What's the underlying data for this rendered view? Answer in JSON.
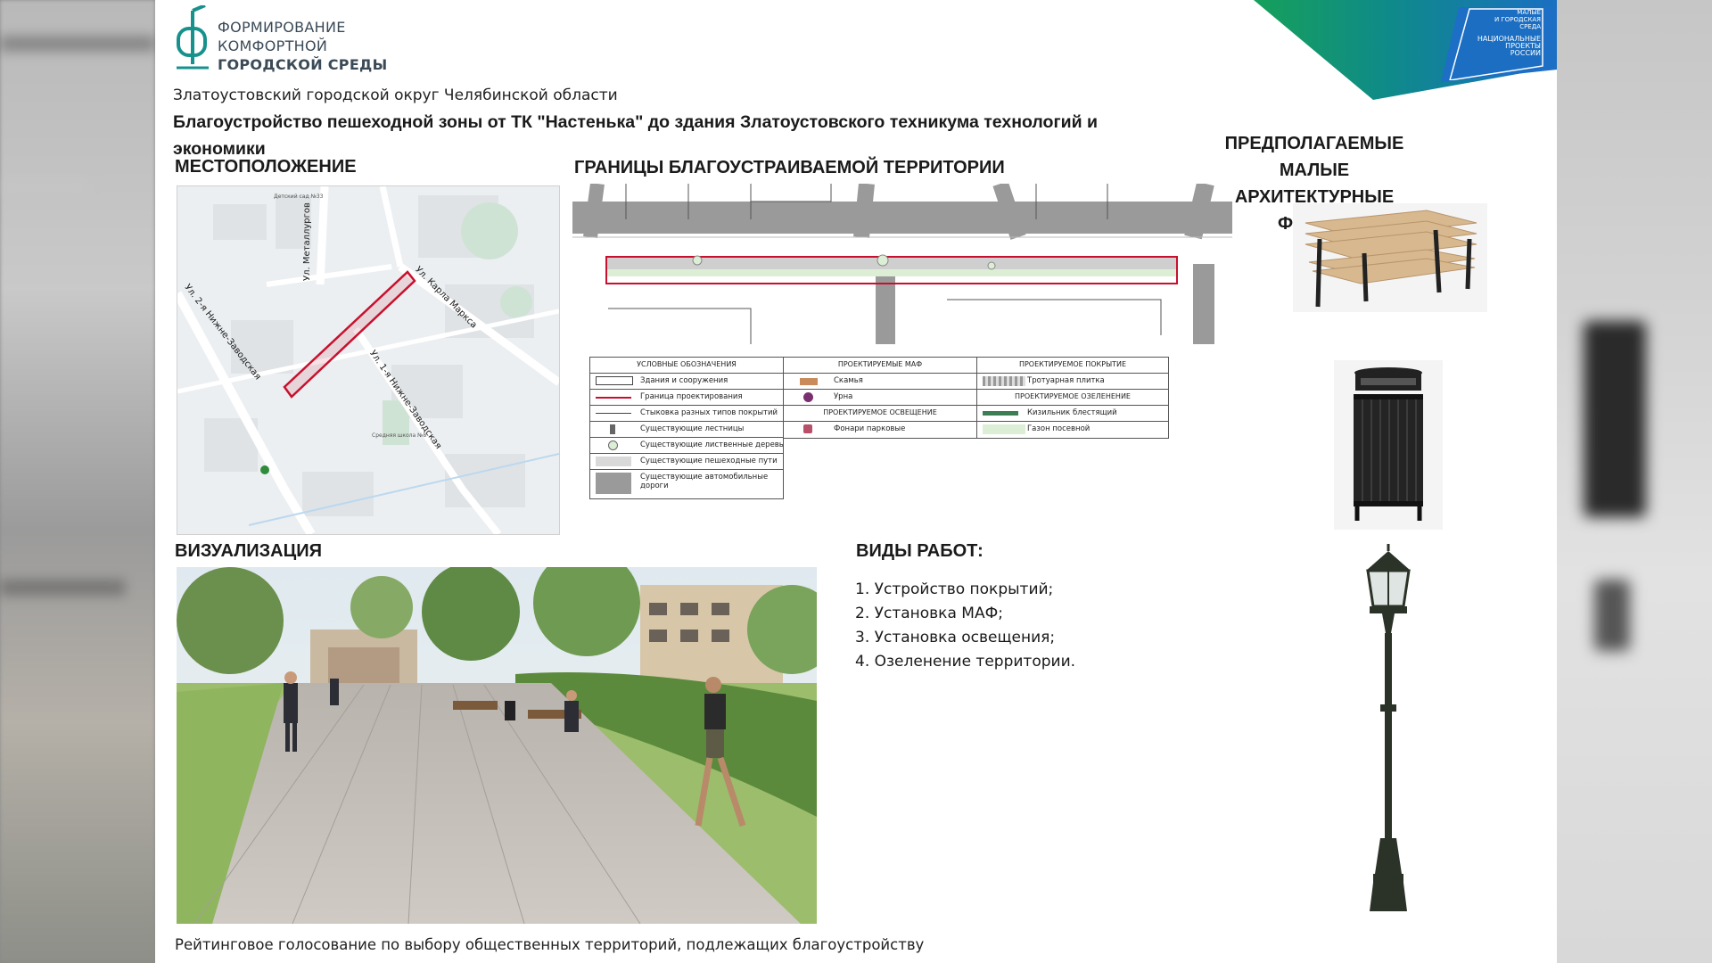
{
  "logo": {
    "line1": "ФОРМИРОВАНИЕ",
    "line2": "КОМФОРТНОЙ",
    "line3": "ГОРОДСКОЙ СРЕДЫ"
  },
  "national_projects": {
    "line1": "МАЛЫЕ",
    "line2": "И ГОРОДСКАЯ СРЕДА",
    "line3": "НАЦИОНАЛЬНЫЕ",
    "line4": "ПРОЕКТЫ",
    "line5": "РОССИИ"
  },
  "region": "Златоустовский городской округ Челябинской области",
  "project_title_line1": "Благоустройство пешеходной зоны от ТК \"Настенька\" до здания Златоустовского техникума технологий и",
  "project_title_line2": "экономики",
  "sections": {
    "location": "МЕСТОПОЛОЖЕНИЕ",
    "borders": "ГРАНИЦЫ БЛАГОУСТРАИВАЕМОЙ ТЕРРИТОРИИ",
    "maf_line1": "ПРЕДПОЛАГАЕМЫЕ МАЛЫЕ",
    "maf_line2": "АРХИТЕКТУРНЫЕ ФОРМЫ",
    "visualization": "ВИЗУАЛИЗАЦИЯ",
    "works": "ВИДЫ РАБОТ:"
  },
  "map_labels": {
    "street_metallurgov": "Ул. Металлургов",
    "street_marksa": "Ул. Карла Маркса",
    "street_2nz": "Ул. 2-я Нижне-Заводская",
    "street_1nz": "Ул. 1-я Нижне-Заводская",
    "kindergarten": "Детский сад №33",
    "school": "Средняя школа №8"
  },
  "legend": {
    "col1_title": "УСЛОВНЫЕ ОБОЗНАЧЕНИЯ",
    "col1": [
      "Здания и сооружения",
      "Граница проектирования",
      "Стыковка разных типов покрытий",
      "Существующие лестницы",
      "Существующие лиственные деревья",
      "Существующие пешеходные пути",
      "Существующие автомобильные дороги"
    ],
    "col2_title": "ПРОЕКТИРУЕМЫЕ МАФ",
    "col2": [
      "Скамья",
      "Урна"
    ],
    "col2b_title": "ПРОЕКТИРУЕМОЕ ОСВЕЩЕНИЕ",
    "col2b": [
      "Фонари парковые"
    ],
    "col3_title": "ПРОЕКТИРУЕМОЕ ПОКРЫТИЕ",
    "col3": [
      "Тротуарная плитка"
    ],
    "col3b_title": "ПРОЕКТИРУЕМОЕ ОЗЕЛЕНЕНИЕ",
    "col3b": [
      "Кизильник блестящий",
      "Газон посевной"
    ]
  },
  "works": [
    "1. Устройство покрытий;",
    "2. Установка МАФ;",
    "3. Установка освещения;",
    "4. Озеленение территории."
  ],
  "footer": "Рейтинговое голосование по выбору общественных территорий, подлежащих благоустройству",
  "colors": {
    "accent_teal": "#0f8a8a",
    "accent_blue": "#1a6fc2",
    "accent_green": "#16a05a",
    "border_red": "#c8102e"
  }
}
